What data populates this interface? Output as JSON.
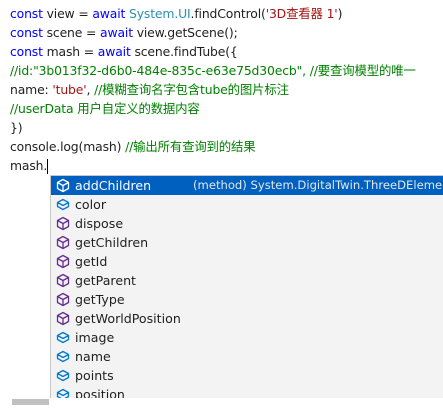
{
  "code": {
    "lines": [
      [
        {
          "t": "const",
          "c": "kw"
        },
        {
          "t": " view = ",
          "c": "plain"
        },
        {
          "t": "await",
          "c": "kw"
        },
        {
          "t": " ",
          "c": "plain"
        },
        {
          "t": "System.UI",
          "c": "type"
        },
        {
          "t": ".findControl(",
          "c": "plain"
        },
        {
          "t": "'3D查看器 1'",
          "c": "str"
        },
        {
          "t": ")",
          "c": "plain"
        }
      ],
      [
        {
          "t": "const",
          "c": "kw"
        },
        {
          "t": " scene = ",
          "c": "plain"
        },
        {
          "t": "await",
          "c": "kw"
        },
        {
          "t": " view.getScene();",
          "c": "plain"
        }
      ],
      [
        {
          "t": "const",
          "c": "kw"
        },
        {
          "t": " mash = ",
          "c": "plain"
        },
        {
          "t": "await",
          "c": "kw"
        },
        {
          "t": " scene.findTube({",
          "c": "plain"
        }
      ],
      [
        {
          "t": "//id:\"3b013f32-d6b0-484e-835c-e63e75d30ecb\", //要查询模型的唯一",
          "c": "cmt"
        }
      ],
      [
        {
          "t": "name: ",
          "c": "plain"
        },
        {
          "t": "'tube'",
          "c": "str"
        },
        {
          "t": ", ",
          "c": "plain"
        },
        {
          "t": "//模糊查询名字包含tube的图片标注",
          "c": "cmt"
        }
      ],
      [
        {
          "t": "//userData 用户自定义的数据内容",
          "c": "cmt"
        }
      ],
      [
        {
          "t": "})",
          "c": "plain"
        }
      ],
      [
        {
          "t": "console.log(mash) ",
          "c": "plain"
        },
        {
          "t": "//输出所有查询到的结果",
          "c": "cmt"
        }
      ],
      [
        {
          "t": "mash.",
          "c": "plain"
        }
      ]
    ]
  },
  "suggestions": {
    "selected_detail": "(method) System.DigitalTwin.ThreeDElement.",
    "items": [
      {
        "label": "addChildren",
        "icon": "method-icon",
        "selected": true
      },
      {
        "label": "color",
        "icon": "property-icon"
      },
      {
        "label": "dispose",
        "icon": "method-icon"
      },
      {
        "label": "getChildren",
        "icon": "method-icon"
      },
      {
        "label": "getId",
        "icon": "method-icon"
      },
      {
        "label": "getParent",
        "icon": "method-icon"
      },
      {
        "label": "getType",
        "icon": "method-icon"
      },
      {
        "label": "getWorldPosition",
        "icon": "method-icon"
      },
      {
        "label": "image",
        "icon": "property-icon"
      },
      {
        "label": "name",
        "icon": "property-icon"
      },
      {
        "label": "points",
        "icon": "property-icon"
      },
      {
        "label": "position",
        "icon": "property-icon"
      }
    ]
  },
  "colors": {
    "keyword": "#0000ff",
    "type": "#2b91af",
    "string": "#a31515",
    "comment": "#008000",
    "selection": "#0060c0",
    "method_icon": "#652d90",
    "property_icon": "#007acc"
  }
}
